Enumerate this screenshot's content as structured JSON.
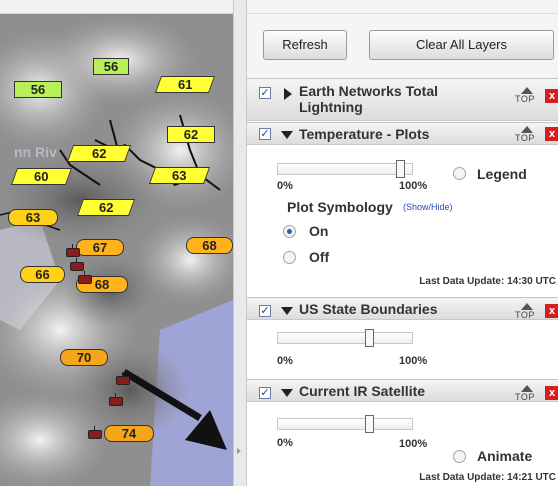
{
  "toolbar": {
    "refresh_label": "Refresh",
    "clear_label": "Clear All Layers"
  },
  "map": {
    "region_label": "nn Riv",
    "plots": [
      {
        "value": "56",
        "color": "#b9f05a"
      },
      {
        "value": "56",
        "color": "#b9f05a"
      },
      {
        "value": "61",
        "color": "#ffff33"
      },
      {
        "value": "62",
        "color": "#ffff33"
      },
      {
        "value": "62",
        "color": "#ffff33"
      },
      {
        "value": "60",
        "color": "#ffff33"
      },
      {
        "value": "63",
        "color": "#ffff33"
      },
      {
        "value": "63",
        "color": "#ffd11a"
      },
      {
        "value": "62",
        "color": "#ffff33"
      },
      {
        "value": "67",
        "color": "#ffb21a"
      },
      {
        "value": "68",
        "color": "#ffb21a"
      },
      {
        "value": "66",
        "color": "#ffd11a"
      },
      {
        "value": "68",
        "color": "#ffb21a"
      },
      {
        "value": "70",
        "color": "#f5a51a"
      },
      {
        "value": "74",
        "color": "#f5a51a"
      }
    ]
  },
  "layers": [
    {
      "title": "Earth Networks Total Lightning",
      "checked": true,
      "expanded": false,
      "top_label": "TOP",
      "close_label": "x"
    },
    {
      "title": "Temperature - Plots",
      "checked": true,
      "expanded": true,
      "top_label": "TOP",
      "close_label": "x",
      "opacity_pct": 95,
      "pct_min": "0%",
      "pct_max": "100%",
      "legend_label": "Legend",
      "symbology_label": "Plot Symbology",
      "show_hide_label": "(Show/Hide)",
      "on_label": "On",
      "off_label": "Off",
      "symbology_selected": "On",
      "update_label": "Last Data Update:",
      "update_time": "14:30 UTC"
    },
    {
      "title": "US State Boundaries",
      "checked": true,
      "expanded": true,
      "top_label": "TOP",
      "close_label": "x",
      "opacity_pct": 70,
      "pct_min": "0%",
      "pct_max": "100%"
    },
    {
      "title": "Current IR Satellite",
      "checked": true,
      "expanded": true,
      "top_label": "TOP",
      "close_label": "x",
      "opacity_pct": 70,
      "pct_min": "0%",
      "pct_max": "100%",
      "animate_label": "Animate",
      "update_label": "Last Data Update:",
      "update_time": "14:21 UTC"
    }
  ],
  "colors": {
    "accent_blue": "#2c49b8",
    "close_red": "#d21f1f"
  }
}
